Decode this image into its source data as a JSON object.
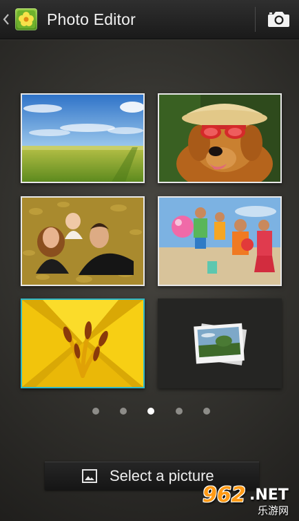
{
  "action_bar": {
    "title": "Photo Editor",
    "icons": {
      "back": "chevron-left-icon",
      "app": "photo-editor-app-icon",
      "camera": "camera-icon"
    }
  },
  "gallery": {
    "tiles": [
      {
        "subject": "green field under blue sky",
        "selected": false
      },
      {
        "subject": "dog wearing hat and red sunglasses",
        "selected": false
      },
      {
        "subject": "family of three lying in autumn leaves",
        "selected": false
      },
      {
        "subject": "children with beach ball on beach",
        "selected": false
      },
      {
        "subject": "yellow lily close-up",
        "selected": true
      },
      {
        "subject": "empty slot with photos icon",
        "selected": false
      }
    ],
    "accent_color": "#2fb9c9"
  },
  "pager": {
    "pages": 5,
    "current_page": 3
  },
  "bottom_bar": {
    "select_label": "Select a picture",
    "icon": "image-icon"
  },
  "watermark": {
    "logo_number": "962",
    "logo_domain": ".NET",
    "logo_subtitle": "乐游网"
  }
}
